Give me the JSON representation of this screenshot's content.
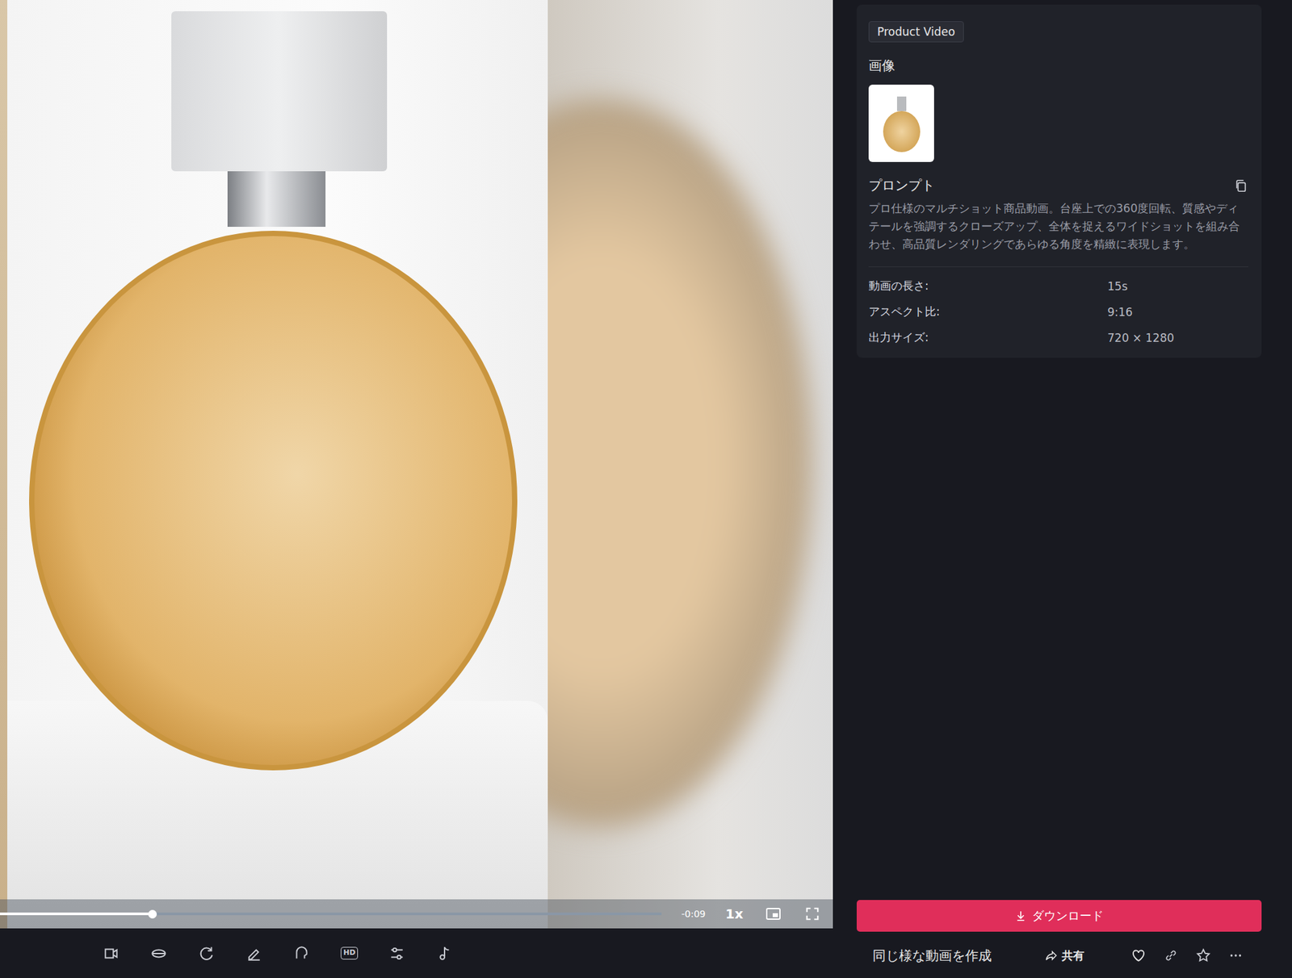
{
  "player": {
    "progress": 0.23,
    "remaining": "-0:09",
    "speed": "1x"
  },
  "toolbar": {
    "hd": "HD"
  },
  "details": {
    "tag": "Product Video",
    "image_label": "画像",
    "prompt_label": "プロンプト",
    "prompt": "プロ仕様のマルチショット商品動画。台座上での360度回転、質感やディテールを強調するクローズアップ、全体を捉えるワイドショットを組み合わせ、高品質レンダリングであらゆる角度を精緻に表現します。",
    "specs": [
      {
        "label": "動画の長さ:",
        "value": "15s"
      },
      {
        "label": "アスペクト比:",
        "value": "9:16"
      },
      {
        "label": "出力サイズ:",
        "value": "720 × 1280"
      }
    ]
  },
  "actions": {
    "download": "ダウンロード",
    "create_similar": "同じ様な動画を作成",
    "share": "共有"
  }
}
